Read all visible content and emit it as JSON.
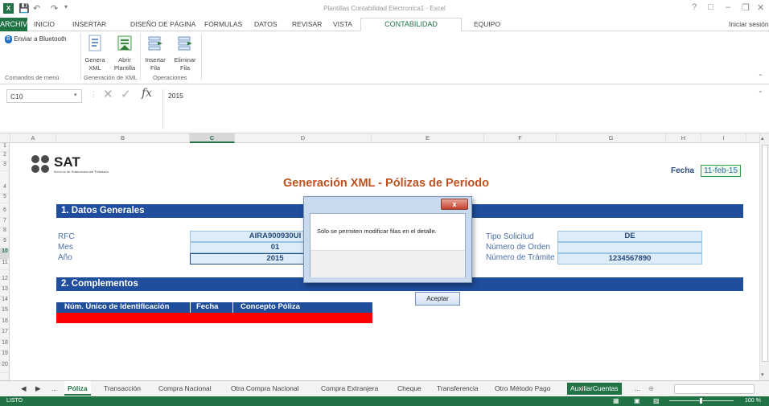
{
  "window": {
    "title": "Plantillas Contabilidad Electronica1 - Excel",
    "help": "?",
    "restore": "□",
    "minimize": "–",
    "maximize": "❐",
    "close": "✕"
  },
  "ribbon_tabs": [
    "ARCHIVO",
    "INICIO",
    "INSERTAR",
    "DISEÑO DE PÁGINA",
    "FÓRMULAS",
    "DATOS",
    "REVISAR",
    "VISTA",
    "CONTABILIDAD ELECTRÓNICA",
    "EQUIPO"
  ],
  "sign_in": "Iniciar sesión",
  "ribbon": {
    "bluetooth_label": "Enviar a Bluetooth",
    "buttons": [
      {
        "label1": "Genera",
        "label2": "XML"
      },
      {
        "label1": "Abrir",
        "label2": "Plantilla"
      },
      {
        "label1": "Insertar",
        "label2": "Fila"
      },
      {
        "label1": "Eliminar",
        "label2": "Fila"
      }
    ],
    "groups": [
      "Comandos de menú",
      "Generación de XML",
      "Operaciones"
    ]
  },
  "formula_bar": {
    "name_box": "C10",
    "fx": "fx",
    "value": "2015"
  },
  "columns": [
    "A",
    "B",
    "C",
    "D",
    "E",
    "F",
    "G",
    "H",
    "I"
  ],
  "rows": [
    "1",
    "2",
    "3",
    "4",
    "5",
    "6",
    "7",
    "8",
    "9",
    "10",
    "11",
    "12",
    "13",
    "14",
    "15",
    "16",
    "17",
    "18",
    "19",
    "20"
  ],
  "sheet": {
    "logo_text": "SAT",
    "logo_sub": "Servicio de Administración Tributaria",
    "title": "Generación XML - Pólizas de Periodo",
    "fecha_label": "Fecha",
    "fecha_value": "11-feb-15",
    "section1": "1. Datos Generales",
    "section2": "2. Complementos",
    "rfc_label": "RFC",
    "rfc_value": "AIRA900930UI",
    "mes_label": "Mes",
    "mes_value": "01",
    "anio_label": "Año",
    "anio_value": "2015",
    "tipo_label": "Tipo Solicitud",
    "tipo_value": "DE",
    "orden_label": "Número de Orden",
    "orden_value": "",
    "tramite_label": "Número de Trámite",
    "tramite_value": "1234567890",
    "table_headers": [
      "Núm. Único de Identificación",
      "Fecha",
      "Concepto Póliza"
    ]
  },
  "dialog": {
    "message": "Sólo se permiten modificar filas en el detalle.",
    "button": "Aceptar",
    "close": "x"
  },
  "sheet_tabs": [
    "Póliza",
    "Transacción",
    "Compra Nacional",
    "Otra Compra Nacional",
    "Compra Extranjera",
    "Cheque",
    "Transferencia",
    "Otro Método Pago",
    "AuxiliarCuentas"
  ],
  "status": {
    "mode": "LISTO",
    "zoom": "100 %"
  },
  "colors": {
    "excel_green": "#217346",
    "banner_blue": "#1e4e9c",
    "title_orange": "#c0501f",
    "table_red": "#ff0000"
  }
}
